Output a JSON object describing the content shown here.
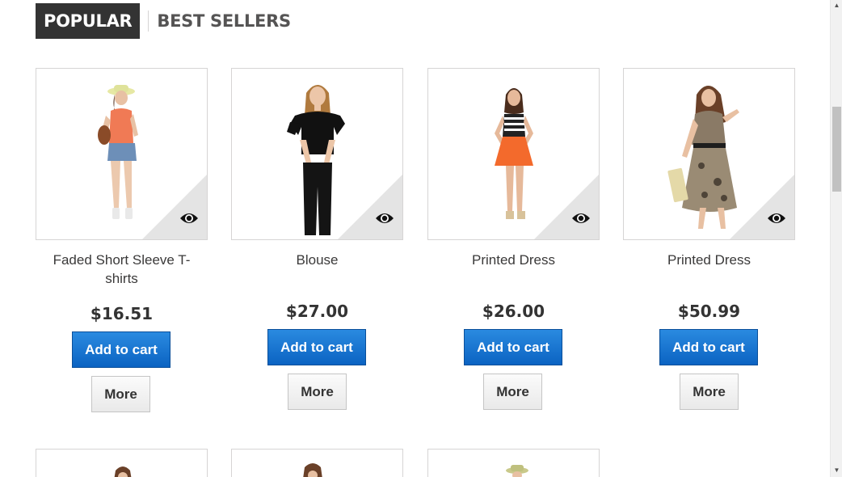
{
  "tabs": [
    {
      "label": "POPULAR",
      "active": true
    },
    {
      "label": "BEST SELLERS",
      "active": false
    }
  ],
  "products": [
    {
      "name": "Faded Short Sleeve T-shirts",
      "price": "$16.51",
      "add_to_cart": "Add to cart",
      "more": "More"
    },
    {
      "name": "Blouse",
      "price": "$27.00",
      "add_to_cart": "Add to cart",
      "more": "More"
    },
    {
      "name": "Printed Dress",
      "price": "$26.00",
      "add_to_cart": "Add to cart",
      "more": "More"
    },
    {
      "name": "Printed Dress",
      "price": "$50.99",
      "add_to_cart": "Add to cart",
      "more": "More"
    }
  ],
  "icons": {
    "quick_view": "eye-icon",
    "scroll_up": "arrow-up-icon",
    "scroll_down": "arrow-down-icon"
  },
  "colors": {
    "tab_active_bg": "#333333",
    "cart_button": "#1a76d2",
    "border": "#d6d4d4"
  }
}
